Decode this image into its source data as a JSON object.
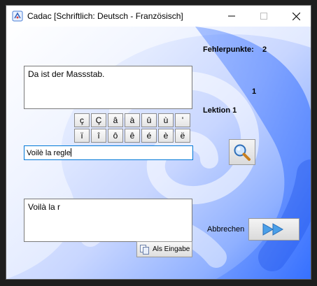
{
  "window": {
    "title": "Cadac [Schriftlich: Deutsch - Französisch]"
  },
  "source": {
    "text": "Da ist der Massstab."
  },
  "special_chars": {
    "row1": [
      "ç",
      "Ç",
      "â",
      "à",
      "û",
      "ù",
      "'"
    ],
    "row2": [
      "ï",
      "î",
      "ô",
      "ê",
      "é",
      "è",
      "ë"
    ]
  },
  "input": {
    "value": "Voilè la regle"
  },
  "answer": {
    "text": "Voilà la r"
  },
  "stats": {
    "fehler_label": "Fehlerpunkte:",
    "fehler_value": "2",
    "count_value": "1",
    "lektion_label": "Lektion 1"
  },
  "buttons": {
    "als_eingabe_label": "Als Eingabe",
    "abbrechen_label": "Abbrechen"
  },
  "colors": {
    "accent": "#0078d7",
    "background_blue": "#3f78ff"
  },
  "icons": {
    "app": "app-icon",
    "search": "magnifier-icon",
    "next": "double-arrow-icon",
    "copy": "copy-icon"
  }
}
